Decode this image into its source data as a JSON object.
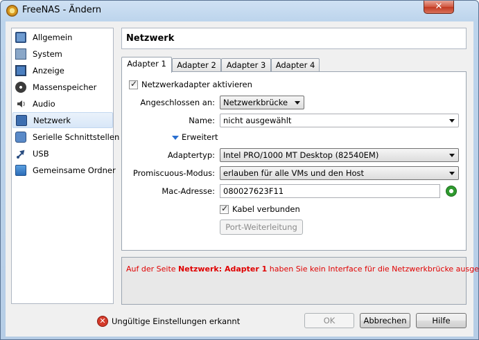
{
  "window": {
    "title": "FreeNAS - Ändern",
    "close_label": "✕"
  },
  "sidebar": {
    "items": [
      {
        "label": "Allgemein",
        "icon": "monitor-icon"
      },
      {
        "label": "System",
        "icon": "chip-icon"
      },
      {
        "label": "Anzeige",
        "icon": "display-icon"
      },
      {
        "label": "Massenspeicher",
        "icon": "disk-icon"
      },
      {
        "label": "Audio",
        "icon": "audio-icon"
      },
      {
        "label": "Netzwerk",
        "icon": "network-icon",
        "selected": true
      },
      {
        "label": "Serielle Schnittstellen",
        "icon": "serial-port-icon"
      },
      {
        "label": "USB",
        "icon": "usb-icon"
      },
      {
        "label": "Gemeinsame Ordner",
        "icon": "folder-icon"
      }
    ]
  },
  "header": {
    "title": "Netzwerk"
  },
  "tabs": [
    {
      "label": "Adapter 1",
      "active": true
    },
    {
      "label": "Adapter 2"
    },
    {
      "label": "Adapter 3"
    },
    {
      "label": "Adapter 4"
    }
  ],
  "adapter": {
    "enable_label": "Netzwerkadapter aktivieren",
    "enabled": true,
    "attached_label": "Angeschlossen an:",
    "attached_value": "Netzwerkbrücke",
    "name_label": "Name:",
    "name_value": "nicht ausgewählt",
    "advanced_label": "Erweitert",
    "adapter_type_label": "Adaptertyp:",
    "adapter_type_value": "Intel PRO/1000 MT Desktop (82540EM)",
    "promisc_label": "Promiscuous-Modus:",
    "promisc_value": "erlauben für alle VMs und den Host",
    "mac_label": "Mac-Adresse:",
    "mac_value": "080027623F11",
    "cable_label": "Kabel verbunden",
    "cable_connected": true,
    "port_forwarding_label": "Port-Weiterleitung"
  },
  "warning": {
    "prefix": "Auf der Seite ",
    "bold": "Netzwerk: Adapter 1",
    "suffix": " haben Sie kein Interface für die Netzwerkbrücke ausgewählt"
  },
  "footer": {
    "status": "Ungültige Einstellungen erkannt",
    "ok_label": "OK",
    "cancel_label": "Abbrechen",
    "help_label": "Hilfe"
  },
  "colors": {
    "warning_text": "#e00000",
    "accent": "#2a6fd0",
    "error_icon": "#d43a2a"
  }
}
